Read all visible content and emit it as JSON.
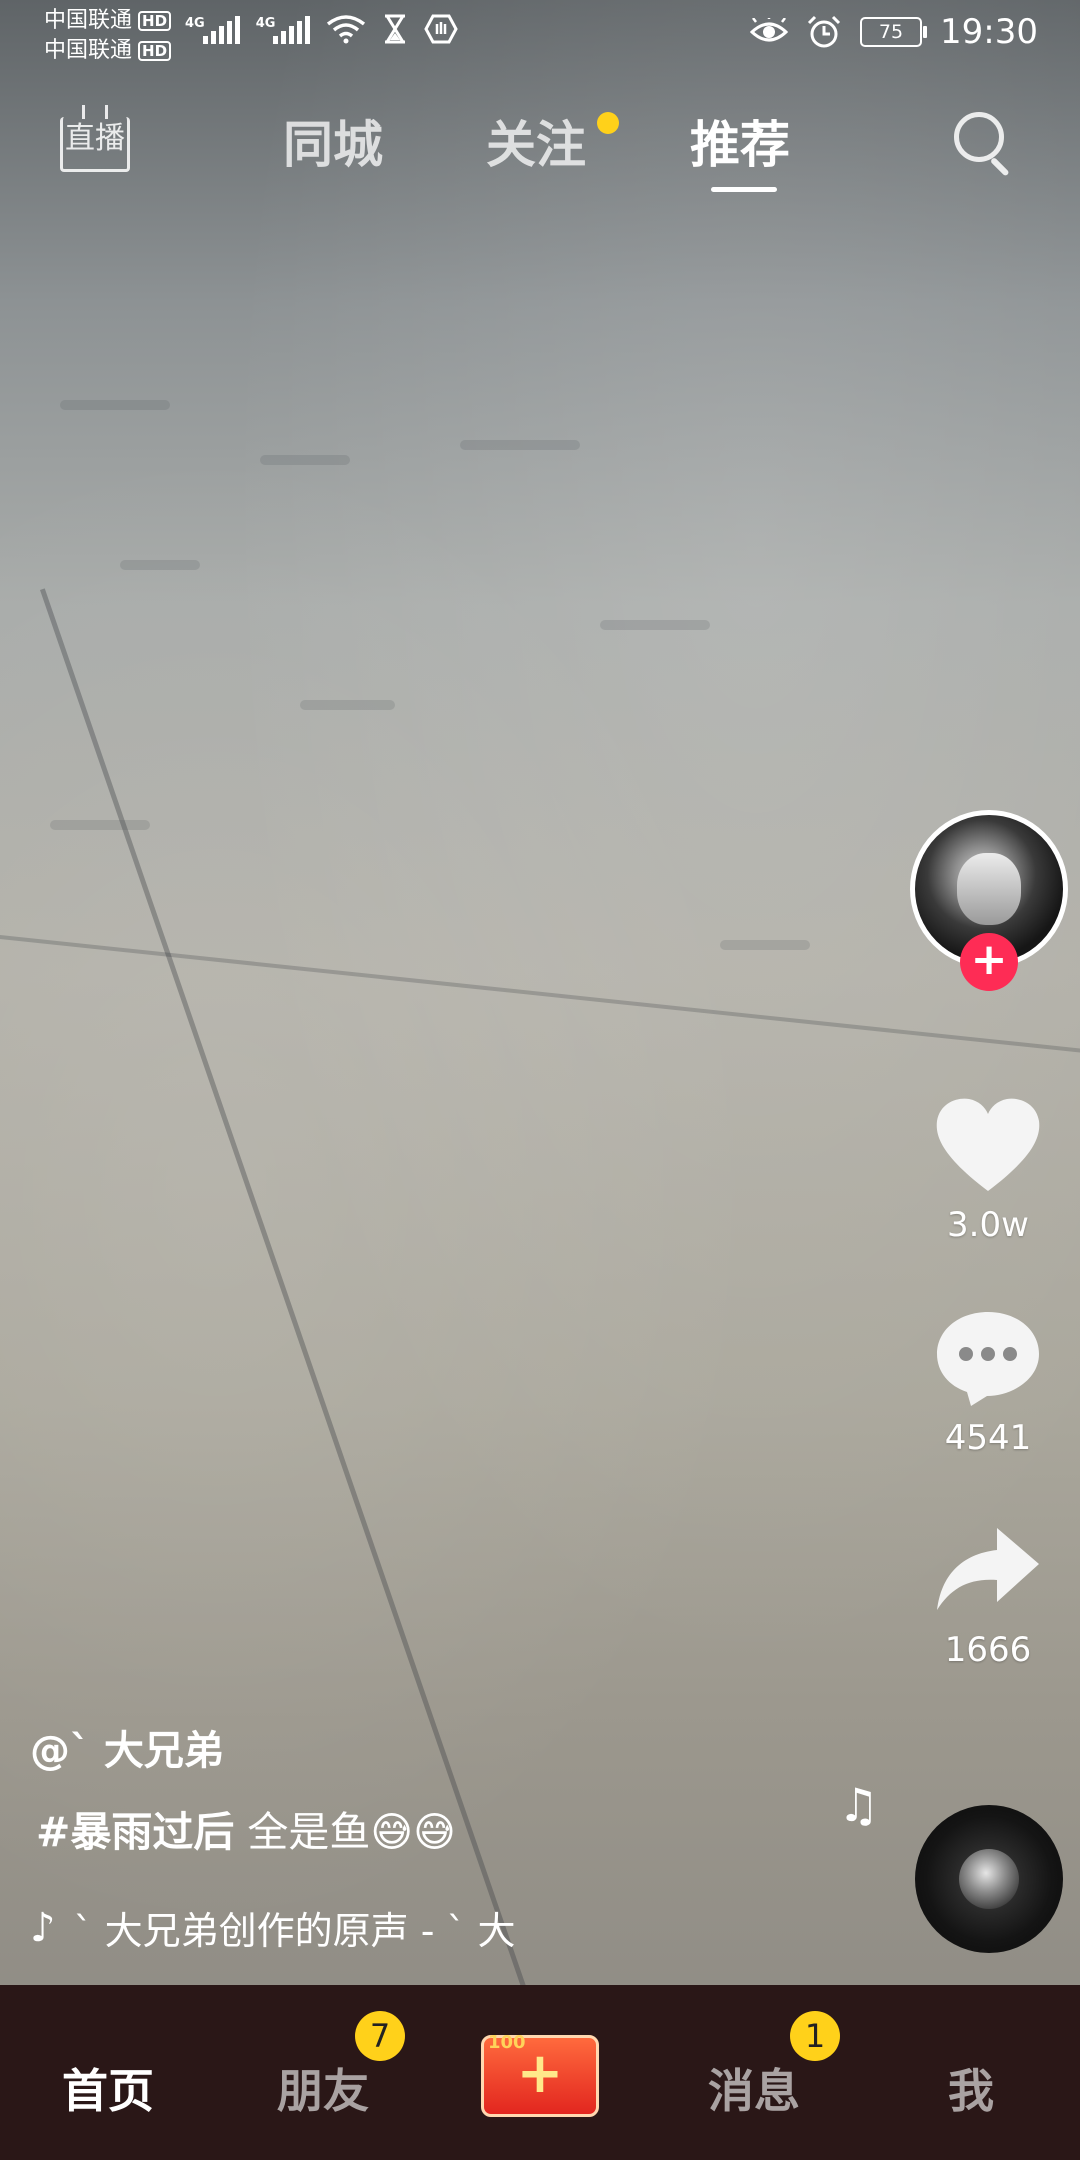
{
  "status_bar": {
    "carrier1": "中国联通",
    "carrier2": "中国联通",
    "hd_label": "HD",
    "network_label": "4G",
    "battery": "75",
    "time": "19:30"
  },
  "top_nav": {
    "live_label": "直播",
    "tabs": [
      {
        "label": "同城"
      },
      {
        "label": "关注"
      },
      {
        "label": "推荐"
      }
    ],
    "active_tab": "推荐"
  },
  "right_rail": {
    "likes": "3.0w",
    "comments": "4541",
    "shares": "1666"
  },
  "video": {
    "author": "@ˋ 大兄弟",
    "hashtag": "#暴雨过后",
    "caption_text": " 全是鱼😅😅",
    "music": "ˋ 大兄弟创作的原声 - ˋ 大"
  },
  "bottom_nav": {
    "items": [
      {
        "label": "首页"
      },
      {
        "label": "朋友",
        "badge": "7"
      },
      {
        "label": "消息",
        "badge": "1"
      },
      {
        "label": "我"
      }
    ],
    "create_tag": "100"
  },
  "colors": {
    "accent_red": "#fe2c55",
    "badge_yellow": "#ffd11a",
    "bottom_bar": "#2a1717"
  }
}
